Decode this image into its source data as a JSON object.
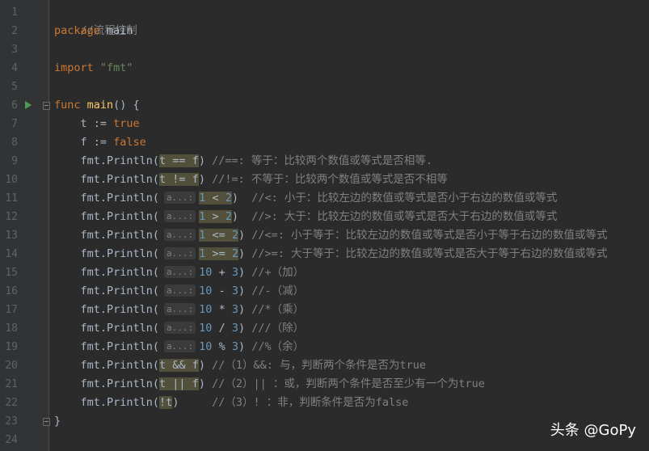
{
  "line_numbers": [
    "1",
    "2",
    "3",
    "4",
    "5",
    "6",
    "7",
    "8",
    "9",
    "10",
    "11",
    "12",
    "13",
    "14",
    "15",
    "16",
    "17",
    "18",
    "19",
    "20",
    "21",
    "22",
    "23",
    "24"
  ],
  "hint_label": "a...:",
  "watermark": "头条 @GoPy",
  "lines": {
    "l1": [
      "//流程控制"
    ],
    "l2": [
      "package",
      " main"
    ],
    "l4": [
      "import",
      " ",
      "\"fmt\""
    ],
    "l6": [
      "func",
      " ",
      "main",
      "() {"
    ],
    "l7": [
      "    t := ",
      "true"
    ],
    "l8": [
      "    f := ",
      "false"
    ],
    "l9": [
      "    fmt.Println(",
      "t == f",
      ") ",
      "//==: 等于：比较两个数值或等式是否相等."
    ],
    "l10": [
      "    fmt.Println(",
      "t != f",
      ") ",
      "//!=: 不等于：比较两个数值或等式是否不相等"
    ],
    "l11": [
      "    fmt.Println(",
      "1",
      " < ",
      "2",
      ")  ",
      "//<: 小于：比较左边的数值或等式是否小于右边的数值或等式"
    ],
    "l12": [
      "    fmt.Println(",
      "1",
      " > ",
      "2",
      ")  ",
      "//>: 大于：比较左边的数值或等式是否大于右边的数值或等式"
    ],
    "l13": [
      "    fmt.Println(",
      "1",
      " <= ",
      "2",
      ") ",
      "//<=: 小于等于：比较左边的数值或等式是否小于等于右边的数值或等式"
    ],
    "l14": [
      "    fmt.Println(",
      "1",
      " >= ",
      "2",
      ") ",
      "//>=: 大于等于：比较左边的数值或等式是否大于等于右边的数值或等式"
    ],
    "l15": [
      "    fmt.Println(",
      "10",
      " + ",
      "3",
      ") ",
      "//+（加）"
    ],
    "l16": [
      "    fmt.Println(",
      "10",
      " - ",
      "3",
      ") ",
      "//-（减）"
    ],
    "l17": [
      "    fmt.Println(",
      "10",
      " * ",
      "3",
      ") ",
      "//*（乘）"
    ],
    "l18": [
      "    fmt.Println(",
      "10",
      " / ",
      "3",
      ") ",
      "///（除）"
    ],
    "l19": [
      "    fmt.Println(",
      "10",
      " % ",
      "3",
      ") ",
      "//%（余）"
    ],
    "l20": [
      "    fmt.Println(",
      "t && f",
      ") ",
      "//（1）&&: 与，判断两个条件是否为true"
    ],
    "l21": [
      "    fmt.Println(",
      "t || f",
      ") ",
      "//（2）|| ：或，判断两个条件是否至少有一个为true"
    ],
    "l22": [
      "    fmt.Println(",
      "!t",
      ")     ",
      "//（3）! ：非，判断条件是否为false"
    ],
    "l23": [
      "}"
    ]
  }
}
